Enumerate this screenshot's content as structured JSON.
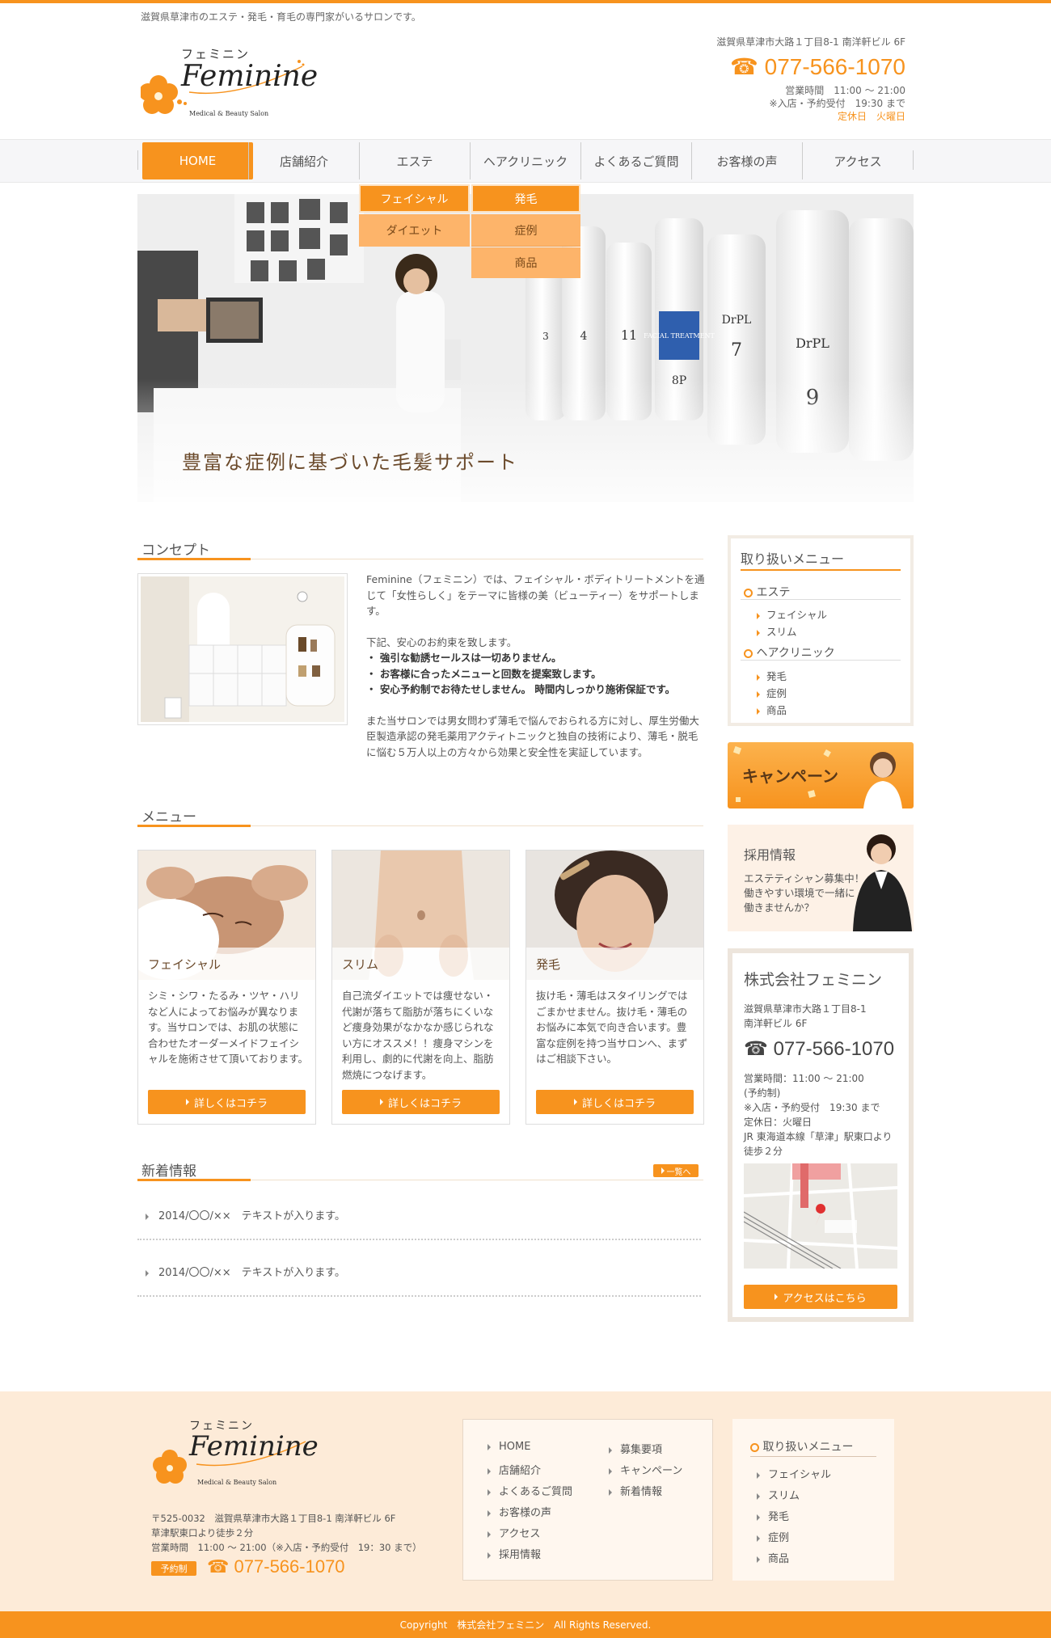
{
  "header": {
    "tagline": "滋賀県草津市のエステ・発毛・育毛の専門家がいるサロンです。",
    "logo_kana": "フェミニン",
    "logo_en": "Feminine",
    "logo_sub": "Medical & Beauty Salon",
    "address": "滋賀県草津市大路１丁目8-1 南洋軒ビル 6F",
    "phone": "077-566-1070",
    "hours": "営業時間　11:00 ～ 21:00",
    "reception": "※入店・予約受付　19:30 まで",
    "holiday": "定休日　火曜日"
  },
  "nav": {
    "items": [
      "HOME",
      "店舗紹介",
      "エステ",
      "ヘアクリニック",
      "よくあるご質問",
      "お客様の声",
      "アクセス"
    ],
    "submenu_este": [
      "フェイシャル",
      "ダイエット"
    ],
    "submenu_hair": [
      "発毛",
      "症例",
      "商品"
    ]
  },
  "hero": {
    "caption": "豊富な症例に基づいた毛髪サポート",
    "bottle_labels": [
      "FACIAL TREATMENT",
      "DrPL",
      "No. 7",
      "DrPL",
      "No. 9",
      "8P",
      "11",
      "4",
      "3"
    ]
  },
  "concept": {
    "title": "コンセプト",
    "para1": "Feminine（フェミニン）では、フェイシャル・ボディトリートメントを通じて「女性らしく」をテーマに皆様の美（ビューティー）をサポートします。",
    "para2_intro": "下記、安心のお約束を致します。",
    "promises": [
      "・ 強引な勧誘セールスは一切ありません。",
      "・ お客様に合ったメニューと回数を提案致します。",
      "・ 安心予約制でお待たせしません。 時間内しっかり施術保証です。"
    ],
    "para3": "また当サロンでは男女問わず薄毛で悩んでおられる方に対し、厚生労働大臣製造承認の発毛薬用アクティトニックと独自の技術により、薄毛・脱毛に悩む５万人以上の方々から効果と安全性を実証しています。"
  },
  "menu": {
    "title": "メニュー",
    "cards": [
      {
        "label": "フェイシャル",
        "desc": "シミ・シワ・たるみ・ツヤ・ハリなど人によってお悩みが異なります。当サロンでは、お肌の状態に合わせたオーダーメイドフェイシャルを施術させて頂いております。",
        "button": "詳しくはコチラ"
      },
      {
        "label": "スリム",
        "desc": "自己流ダイエットでは痩せない・代謝が落ちて脂肪が落ちにくいなど痩身効果がなかなか感じられない方にオススメ！！痩身マシンを利用し、劇的に代謝を向上、脂肪燃焼につなげます。",
        "button": "詳しくはコチラ"
      },
      {
        "label": "発毛",
        "desc": "抜け毛・薄毛はスタイリングではごまかせません。抜け毛・薄毛のお悩みに本気で向き合います。豊富な症例を持つ当サロンへ、まずはご相談下さい。",
        "button": "詳しくはコチラ"
      }
    ]
  },
  "news": {
    "title": "新着情報",
    "list_button": "一覧へ",
    "items": [
      {
        "date": "2014/〇〇/××",
        "text": "テキストが入ります。"
      },
      {
        "date": "2014/〇〇/××",
        "text": "テキストが入ります。"
      }
    ]
  },
  "sidebar": {
    "menu_title": "取り扱いメニュー",
    "este_title": "エステ",
    "este_links": [
      "フェイシャル",
      "スリム"
    ],
    "hair_title": "ヘアクリニック",
    "hair_links": [
      "発毛",
      "症例",
      "商品"
    ],
    "campaign": "キャンペーン",
    "recruit_title": "採用情報",
    "recruit_text": [
      "エステティシャン募集中！",
      "働きやすい環境で一緒に",
      "働きませんか？"
    ],
    "company_name": "株式会社フェミニン",
    "company_address": [
      "滋賀県草津市大路１丁目8-1",
      "南洋軒ビル 6F"
    ],
    "company_phone": "077-566-1070",
    "company_info": [
      "営業時間：11:00 ～ 21:00",
      "(予約制)",
      "※入店・予約受付　19:30 まで",
      "定休日：火曜日",
      "JR 東海道本線「草津」駅東口より",
      "徒歩２分"
    ],
    "access_button": "アクセスはこちら"
  },
  "footer": {
    "logo_kana": "フェミニン",
    "logo_en": "Feminine",
    "logo_sub": "Medical & Beauty Salon",
    "address": "〒525-0032　滋賀県草津市大路１丁目8-1 南洋軒ビル 6F",
    "station": "草津駅東口より徒歩２分",
    "hours": "営業時間　11:00 ～ 21:00（※入店・予約受付　19：30 まで）",
    "reservation_badge": "予約制",
    "phone": "077-566-1070",
    "links_col1": [
      "HOME",
      "店舗紹介",
      "よくあるご質問",
      "お客様の声",
      "アクセス",
      "採用情報"
    ],
    "links_col2": [
      "募集要項",
      "キャンペーン",
      "新着情報"
    ],
    "menu_title": "取り扱いメニュー",
    "menu_links": [
      "フェイシャル",
      "スリム",
      "発毛",
      "症例",
      "商品"
    ],
    "copyright": "Copyright　株式会社フェミニン　All Rights Reserved."
  },
  "colors": {
    "accent": "#f7931e",
    "cream": "#fdebd8",
    "text": "#555555"
  }
}
